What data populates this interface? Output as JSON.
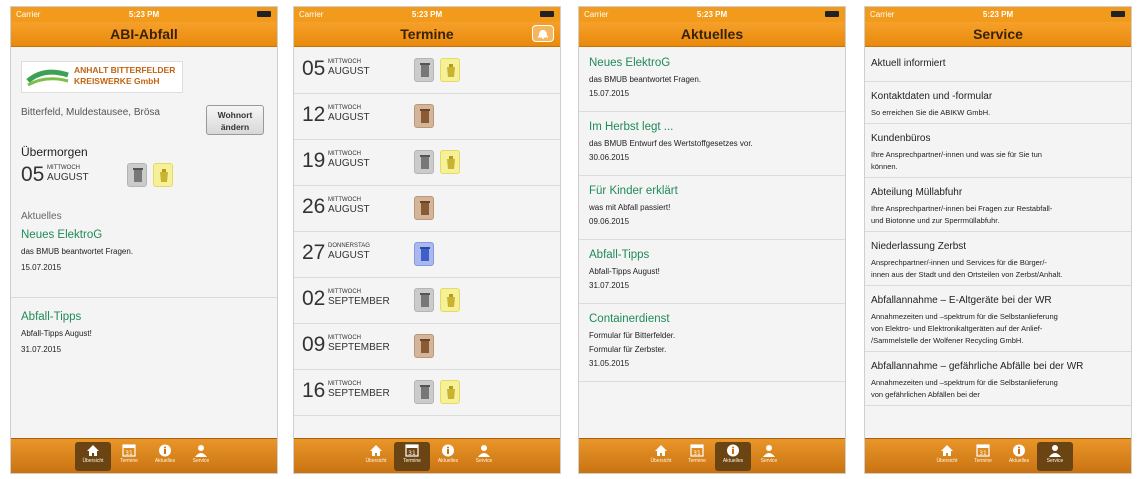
{
  "status": {
    "carrier": "Carrier",
    "time": "5:23 PM"
  },
  "tabs": [
    "Übersicht",
    "Termine",
    "Aktuelles",
    "Service"
  ],
  "colors": {
    "accent": "#f29a1c",
    "news_green": "#1f8b57"
  },
  "screen1": {
    "title": "ABI-Abfall",
    "logo": {
      "line1": "ANHALT BITTERFELDER",
      "line2": "KREISWERKE GmbH"
    },
    "location": "Bitterfeld, Muldestausee, Brösa",
    "button_line1": "Wohnort",
    "button_line2": "ändern",
    "next_label": "Übermorgen",
    "next": {
      "day": "05",
      "weekday": "MITTWOCH",
      "month": "AUGUST"
    },
    "section": "Aktuelles",
    "news": [
      {
        "title": "Neues ElektroG",
        "sub": "das BMUB beantwortet Fragen.",
        "date": "15.07.2015"
      },
      {
        "title": "Abfall-Tipps",
        "sub": "Abfall-Tipps August!",
        "date": "31.07.2015"
      }
    ]
  },
  "screen2": {
    "title": "Termine",
    "rows": [
      {
        "day": "05",
        "weekday": "MITTWOCH",
        "month": "AUGUST",
        "bins": [
          "grey",
          "yellow"
        ]
      },
      {
        "day": "12",
        "weekday": "MITTWOCH",
        "month": "AUGUST",
        "bins": [
          "brown"
        ]
      },
      {
        "day": "19",
        "weekday": "MITTWOCH",
        "month": "AUGUST",
        "bins": [
          "grey",
          "yellow"
        ]
      },
      {
        "day": "26",
        "weekday": "MITTWOCH",
        "month": "AUGUST",
        "bins": [
          "brown"
        ]
      },
      {
        "day": "27",
        "weekday": "DONNERSTAG",
        "month": "AUGUST",
        "bins": [
          "blue"
        ]
      },
      {
        "day": "02",
        "weekday": "MITTWOCH",
        "month": "SEPTEMBER",
        "bins": [
          "grey",
          "yellow"
        ]
      },
      {
        "day": "09",
        "weekday": "MITTWOCH",
        "month": "SEPTEMBER",
        "bins": [
          "brown"
        ]
      },
      {
        "day": "16",
        "weekday": "MITTWOCH",
        "month": "SEPTEMBER",
        "bins": [
          "grey",
          "yellow"
        ]
      }
    ]
  },
  "screen3": {
    "title": "Aktuelles",
    "news": [
      {
        "title": "Neues ElektroG",
        "lines": [
          "das BMUB beantwortet Fragen."
        ],
        "date": "15.07.2015"
      },
      {
        "title": "Im Herbst legt ...",
        "lines": [
          "das BMUB Entwurf des Wertstoffgesetzes vor."
        ],
        "date": "30.06.2015"
      },
      {
        "title": "Für Kinder erklärt",
        "lines": [
          "was mit Abfall passiert!"
        ],
        "date": "09.06.2015"
      },
      {
        "title": "Abfall-Tipps",
        "lines": [
          "Abfall-Tipps August!"
        ],
        "date": "31.07.2015"
      },
      {
        "title": "Containerdienst",
        "lines": [
          "Formular für Bitterfelder.",
          "Formular für Zerbster."
        ],
        "date": "31.05.2015"
      }
    ]
  },
  "screen4": {
    "title": "Service",
    "items": [
      {
        "title": "Aktuell informiert",
        "desc": []
      },
      {
        "title": "Kontaktdaten und -formular",
        "desc": [
          "So erreichen Sie die ABIKW GmbH."
        ]
      },
      {
        "title": "Kundenbüros",
        "desc": [
          "Ihre Ansprechpartner/-innen und was sie für Sie tun",
          "können."
        ]
      },
      {
        "title": "Abteilung Müllabfuhr",
        "desc": [
          "Ihre Ansprechpartner/-innen bei Fragen zur Restabfall-",
          "und Biotonne und zur Sperrmüllabfuhr."
        ]
      },
      {
        "title": "Niederlassung Zerbst",
        "desc": [
          "Ansprechpartner/-innen und Services für die Bürger/-",
          "innen aus der Stadt und den Ortsteilen von Zerbst/Anhalt."
        ]
      },
      {
        "title": "Abfallannahme – E-Altgeräte bei der WR",
        "desc": [
          "Annahmezeiten und –spektrum für die Selbstanlieferung",
          "von Elektro- und Elektronikaltgeräten auf der Anlief-",
          "/Sammelstelle der Wolfener Recycling GmbH."
        ]
      },
      {
        "title": "Abfallannahme – gefährliche Abfälle bei der WR",
        "desc": [
          "Annahmezeiten und –spektrum für die Selbstanlieferung",
          "von gefährlichen Abfällen bei der"
        ]
      }
    ]
  }
}
